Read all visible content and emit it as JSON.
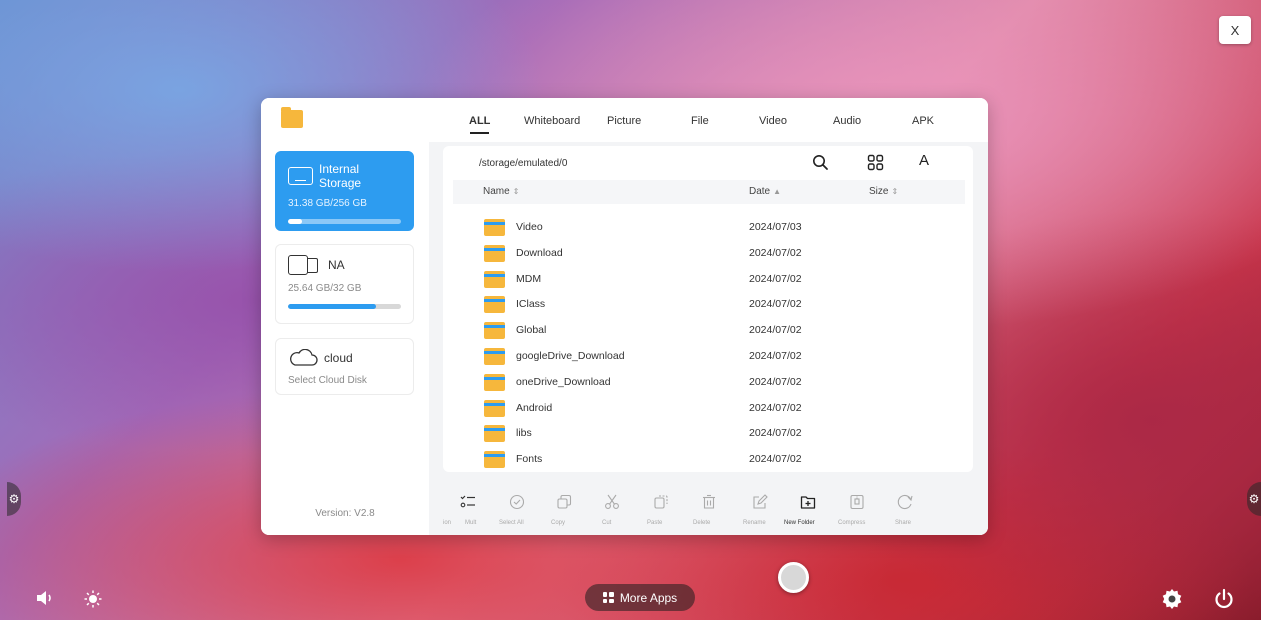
{
  "close_label": "X",
  "window": {
    "version": "Version: V2.8",
    "storages": [
      {
        "name": "Internal Storage",
        "usage": "31.38 GB/256 GB",
        "used_fraction": 0.12
      },
      {
        "name": "NA",
        "usage": "25.64 GB/32 GB",
        "used_fraction": 0.78
      },
      {
        "name": "cloud",
        "usage": "Select Cloud Disk"
      }
    ],
    "tabs": [
      "ALL",
      "Whiteboard",
      "Picture",
      "File",
      "Video",
      "Audio",
      "APK"
    ],
    "active_tab": "ALL",
    "path": "/storage/emulated/0",
    "font_button": "A",
    "columns": {
      "name": "Name",
      "date": "Date",
      "size": "Size"
    },
    "sort_glyph": "⇕",
    "sort_active_glyph": "▲",
    "files": [
      {
        "name": "Video",
        "date": "2024/07/03"
      },
      {
        "name": "Download",
        "date": "2024/07/02"
      },
      {
        "name": "MDM",
        "date": "2024/07/02"
      },
      {
        "name": "IClass",
        "date": "2024/07/02"
      },
      {
        "name": "Global",
        "date": "2024/07/02"
      },
      {
        "name": "googleDrive_Download",
        "date": "2024/07/02"
      },
      {
        "name": "oneDrive_Download",
        "date": "2024/07/02"
      },
      {
        "name": "Android",
        "date": "2024/07/02"
      },
      {
        "name": "libs",
        "date": "2024/07/02"
      },
      {
        "name": "Fonts",
        "date": "2024/07/02"
      }
    ],
    "actions": [
      {
        "label": "ion",
        "icon": "multi-select-icon"
      },
      {
        "label": "Mult",
        "icon": "check-circle-icon"
      },
      {
        "label": "Select All",
        "icon": "copy-icon"
      },
      {
        "label": "Copy",
        "icon": "cut-icon"
      },
      {
        "label": "Cut",
        "icon": "paste-icon"
      },
      {
        "label": "Paste",
        "icon": "delete-icon"
      },
      {
        "label": "Delete",
        "icon": "rename-icon"
      },
      {
        "label": "Rename",
        "icon": "new-folder-icon"
      },
      {
        "label": "New Folder",
        "icon": "compress-icon"
      },
      {
        "label": "Compress",
        "icon": "share-icon"
      },
      {
        "label": "Share",
        "icon": ""
      }
    ]
  },
  "dock": {
    "more_apps": "More Apps"
  },
  "colors": {
    "accent": "#2d9cf0",
    "folder": "#f6b73c"
  }
}
